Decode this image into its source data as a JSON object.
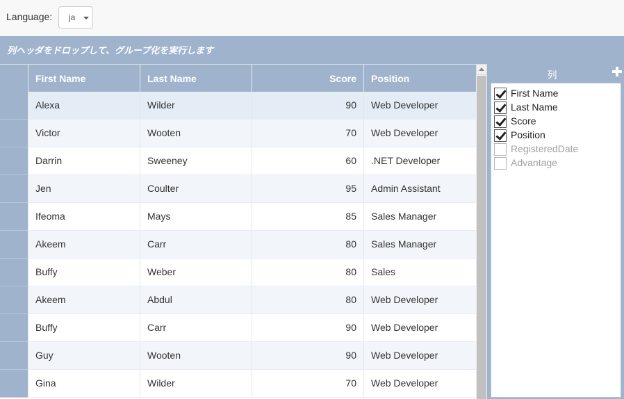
{
  "language": {
    "label": "Language:",
    "value": "ja"
  },
  "group_panel": {
    "hint": "列ヘッダをドロップして、グループ化を実行します"
  },
  "grid": {
    "columns": [
      {
        "label": "First Name"
      },
      {
        "label": "Last Name"
      },
      {
        "label": "Score"
      },
      {
        "label": "Position"
      }
    ],
    "rows": [
      {
        "first": "Alexa",
        "last": "Wilder",
        "score": "90",
        "position": "Web Developer"
      },
      {
        "first": "Victor",
        "last": "Wooten",
        "score": "70",
        "position": "Web Developer"
      },
      {
        "first": "Darrin",
        "last": "Sweeney",
        "score": "60",
        "position": ".NET Developer"
      },
      {
        "first": "Jen",
        "last": "Coulter",
        "score": "95",
        "position": "Admin Assistant"
      },
      {
        "first": "Ifeoma",
        "last": "Mays",
        "score": "85",
        "position": "Sales Manager"
      },
      {
        "first": "Akeem",
        "last": "Carr",
        "score": "80",
        "position": "Sales Manager"
      },
      {
        "first": "Buffy",
        "last": "Weber",
        "score": "80",
        "position": "Sales"
      },
      {
        "first": "Akeem",
        "last": "Abdul",
        "score": "80",
        "position": "Web Developer"
      },
      {
        "first": "Buffy",
        "last": "Carr",
        "score": "90",
        "position": "Web Developer"
      },
      {
        "first": "Guy",
        "last": "Wooten",
        "score": "90",
        "position": "Web Developer"
      },
      {
        "first": "Gina",
        "last": "Wilder",
        "score": "70",
        "position": "Web Developer"
      }
    ]
  },
  "column_chooser": {
    "title": "列",
    "items": [
      {
        "label": "First Name",
        "checked": true
      },
      {
        "label": "Last Name",
        "checked": true
      },
      {
        "label": "Score",
        "checked": true
      },
      {
        "label": "Position",
        "checked": true
      },
      {
        "label": "RegisteredDate",
        "checked": false
      },
      {
        "label": "Advantage",
        "checked": false
      }
    ]
  },
  "colors": {
    "header": "#9fb3cd",
    "selected_row": "#e4ecf5",
    "alt_row": "#f2f6fa"
  }
}
